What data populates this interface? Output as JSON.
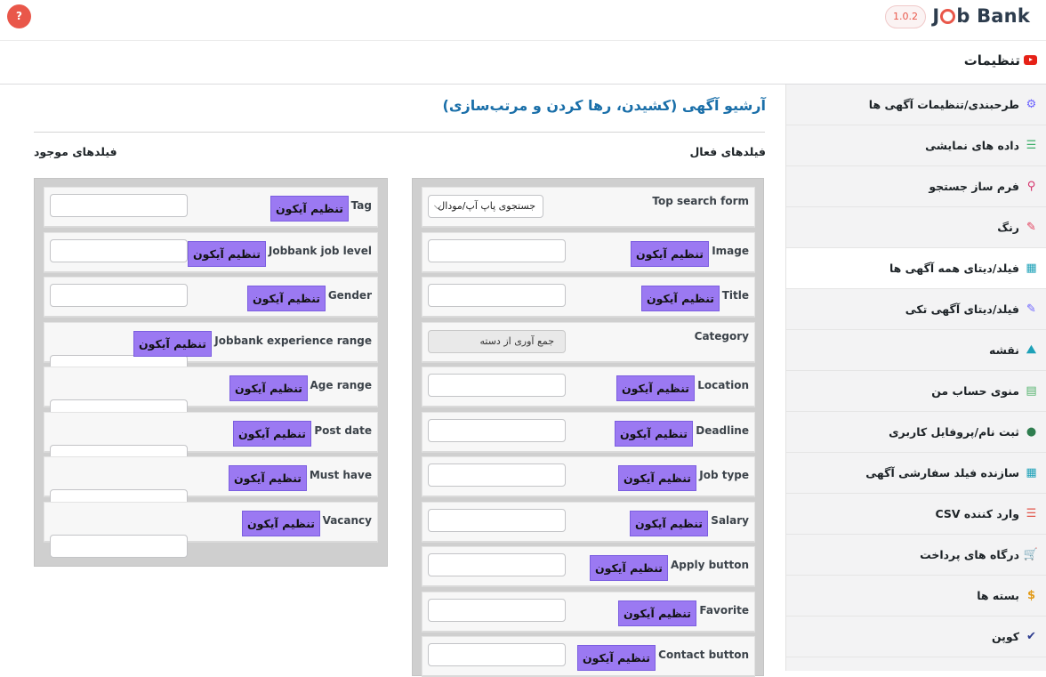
{
  "header": {
    "help_label": "?",
    "logo_text_start": "J",
    "logo_text_end": "b Bank",
    "version": "1.0.2"
  },
  "page_title": "تنظیمات",
  "sidebar": {
    "items": [
      {
        "label": "طرحبندی/تنظیمات آگهی ها",
        "icon": "gear-icon",
        "color": "#6c63ff"
      },
      {
        "label": "داده های نمایشی",
        "icon": "database-icon",
        "color": "#3fb06b"
      },
      {
        "label": "فرم ساز جستجو",
        "icon": "search-icon",
        "color": "#d6336c"
      },
      {
        "label": "رنگ",
        "icon": "brush-icon",
        "color": "#e23c5a"
      },
      {
        "label": "فیلد/دیتای همه آگهی ها",
        "icon": "table-icon",
        "color": "#1da1b8"
      },
      {
        "label": "فیلد/دیتای آگهی تکی",
        "icon": "edit-icon",
        "color": "#6c63ff"
      },
      {
        "label": "نقشه",
        "icon": "map-icon",
        "color": "#1da1b8"
      },
      {
        "label": "منوی حساب من",
        "icon": "menu-icon",
        "color": "#56b46f"
      },
      {
        "label": "ثبت نام/پروفایل کاربری",
        "icon": "user-icon",
        "color": "#2f7d4f"
      },
      {
        "label": "سازنده فیلد سفارشی آگهی",
        "icon": "table-icon",
        "color": "#1da1b8"
      },
      {
        "label": "وارد کننده CSV",
        "icon": "import-icon",
        "color": "#e2574c"
      },
      {
        "label": "درگاه های پرداخت",
        "icon": "cart-icon",
        "color": "#1a8fd6"
      },
      {
        "label": "بسته ها",
        "icon": "coin-icon",
        "color": "#e29b19"
      },
      {
        "label": "کوپن",
        "icon": "check-icon",
        "color": "#2d3c8f"
      }
    ]
  },
  "main": {
    "heading": "آرشیو آگهی (کشیدن، رها کردن و مرتب‌سازی)",
    "active_fields_label": "فیلدهای فعال",
    "available_fields_label": "فیلدهای موجود",
    "icon_button_label": "تنظیم آیکون",
    "active_fields": [
      {
        "name": "Top search form",
        "type": "select",
        "value": "جستجوی پاپ آپ/مودال"
      },
      {
        "name": "Image",
        "type": "field"
      },
      {
        "name": "Title",
        "type": "field"
      },
      {
        "name": "Category",
        "type": "disabled",
        "value": "جمع آوری از دسته"
      },
      {
        "name": "Location",
        "type": "field"
      },
      {
        "name": "Deadline",
        "type": "field"
      },
      {
        "name": "Job type",
        "type": "field"
      },
      {
        "name": "Salary",
        "type": "field"
      },
      {
        "name": "Apply button",
        "type": "field"
      },
      {
        "name": "Favorite",
        "type": "field"
      },
      {
        "name": "Contact button",
        "type": "field"
      }
    ],
    "available_fields": [
      {
        "name": "Tag"
      },
      {
        "name": "Jobbank job level"
      },
      {
        "name": "Gender"
      },
      {
        "name": "Jobbank experience range"
      },
      {
        "name": "Age range"
      },
      {
        "name": "Post date"
      },
      {
        "name": "Must have"
      },
      {
        "name": "Vacancy"
      }
    ]
  }
}
